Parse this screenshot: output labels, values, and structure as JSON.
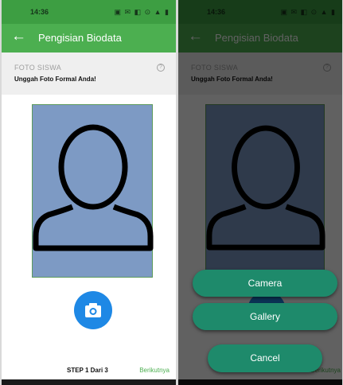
{
  "status_bar": {
    "time": "14:36",
    "icons": "▣ ✉ ◧ ⊙ ▲ ▮"
  },
  "app_bar": {
    "title": "Pengisian Biodata",
    "back_icon": "arrow-left-icon"
  },
  "section": {
    "label": "FOTO SISWA",
    "subtitle": "Unggah Foto Formal Anda!",
    "help_icon": "help-circle-icon",
    "help_glyph": "?"
  },
  "photo": {
    "placeholder_icon": "person-silhouette-icon"
  },
  "fab": {
    "icon": "camera-icon"
  },
  "footer": {
    "step": "STEP 1 Dari 3",
    "next": "Berikutnya"
  },
  "sheet": {
    "camera": "Camera",
    "gallery": "Gallery",
    "cancel": "Cancel"
  },
  "colors": {
    "primary": "#4caf50",
    "status_bar": "#3d9e42",
    "fab": "#1e88e5",
    "sheet_button": "#1e8a6b",
    "photo_bg": "#7d9ac4"
  }
}
